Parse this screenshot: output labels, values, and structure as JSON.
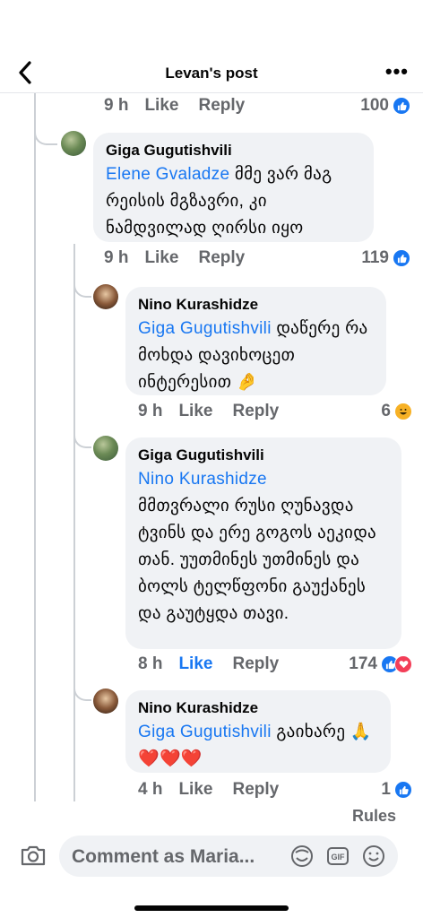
{
  "header": {
    "title": "Levan's post",
    "more": "•••"
  },
  "comments": [
    {
      "name": "Giga Gugutishvili",
      "mention": "Elene Gvaladze",
      "text": " მმე ვარ მაგ რეისის მგზავრი, კი ნამდვილად ღირსი იყო",
      "time": "9 h",
      "like": "Like",
      "reply": "Reply",
      "count": "119"
    },
    {
      "name": "Nino Kurashidze",
      "mention": "Giga Gugutishvili",
      "text": " დაწერე რა მოხდა დავიხოცეთ ინტერესით 🤌",
      "time": "9 h",
      "like": "Like",
      "reply": "Reply",
      "count": "6"
    },
    {
      "name": "Giga Gugutishvili",
      "mention": "Nino Kurashidze",
      "text": "მმთვრალი რუსი ღუნავდა ტვინს და ერე გოგოს აეკიდა თან. უუთმინეს უთმინეს და ბოლს ტელწფონი გაუქანეს და გაუტყდა თავი.",
      "time": "8 h",
      "like": "Like",
      "reply": "Reply",
      "count": "174"
    },
    {
      "name": "Nino Kurashidze",
      "mention": "Giga Gugutishvili",
      "text": " გაიხარე 🙏❤️❤️❤️",
      "time": "4 h",
      "like": "Like",
      "reply": "Reply",
      "count": "1"
    }
  ],
  "previous_row": {
    "time": "9 h",
    "like": "Like",
    "reply": "Reply",
    "count": "100"
  },
  "rules_label": "Rules",
  "composer": {
    "placeholder": "Comment as Maria..."
  },
  "colors": {
    "accent": "#1877f2",
    "bubble": "#f0f2f5",
    "muted": "#65676b"
  }
}
